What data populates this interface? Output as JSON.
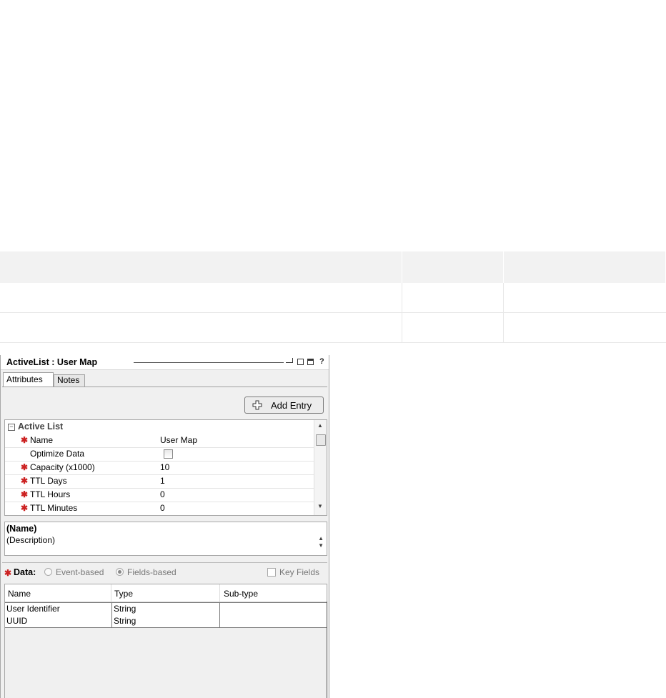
{
  "window": {
    "title": "ActiveList : User Map",
    "help_label": "?"
  },
  "tabs": [
    {
      "label": "Attributes",
      "active": true
    },
    {
      "label": "Notes",
      "active": false
    }
  ],
  "toolbar": {
    "add_entry_label": "Add Entry"
  },
  "grid": {
    "section_label": "Active List",
    "collapse_symbol": "−",
    "rows": [
      {
        "label": "Name",
        "value": "User Map",
        "required": true
      },
      {
        "label": "Optimize Data",
        "value": "",
        "required": false,
        "checkbox": true,
        "checked": false
      },
      {
        "label": "Capacity (x1000)",
        "value": "10",
        "required": true
      },
      {
        "label": "TTL Days",
        "value": "1",
        "required": true
      },
      {
        "label": "TTL Hours",
        "value": "0",
        "required": true
      },
      {
        "label": "TTL Minutes",
        "value": "0",
        "required": true
      }
    ]
  },
  "description": {
    "title": "(Name)",
    "text": "(Description)"
  },
  "data": {
    "label": "Data:",
    "options": [
      {
        "label": "Event-based",
        "selected": false
      },
      {
        "label": "Fields-based",
        "selected": true
      }
    ],
    "key_fields_label": "Key Fields",
    "key_fields_checked": false
  },
  "fields_table": {
    "columns": [
      "Name",
      "Type",
      "Sub-type"
    ],
    "rows": [
      [
        "User Identifier",
        "String",
        ""
      ],
      [
        "UUID",
        "String",
        ""
      ]
    ]
  },
  "colors": {
    "required_marker": "#cc2222",
    "panel_bg": "#f0f0f0"
  }
}
